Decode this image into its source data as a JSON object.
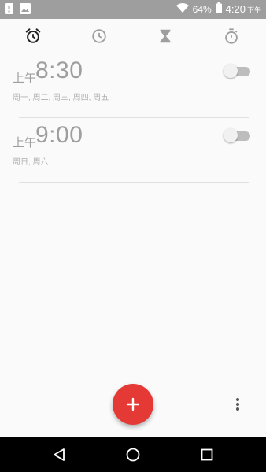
{
  "status_bar": {
    "battery_percent": "64%",
    "time": "4:20",
    "time_suffix": "下午",
    "icons": [
      "notification-icon",
      "image-icon",
      "wifi-icon",
      "battery-icon"
    ]
  },
  "tabs": [
    {
      "icon": "alarm-icon",
      "active": true
    },
    {
      "icon": "clock-icon",
      "active": false
    },
    {
      "icon": "timer-icon",
      "active": false
    },
    {
      "icon": "stopwatch-icon",
      "active": false
    }
  ],
  "alarms": [
    {
      "ampm": "上午",
      "time": "8:30",
      "days": "周一, 周二, 周三, 周四, 周五",
      "enabled": false
    },
    {
      "ampm": "上午",
      "time": "9:00",
      "days": "周日, 周六",
      "enabled": false
    }
  ],
  "fab": {
    "icon": "plus-icon",
    "color": "#e53935"
  },
  "overflow_menu": {
    "icon": "more-vert-icon"
  },
  "nav_bar": {
    "buttons": [
      "back-icon",
      "home-icon",
      "recents-icon"
    ]
  },
  "watermark": "",
  "colors": {
    "status_bar": "#9e9e9e",
    "background": "#fafafa",
    "accent": "#e53935",
    "text_muted": "#9e9e9e"
  }
}
